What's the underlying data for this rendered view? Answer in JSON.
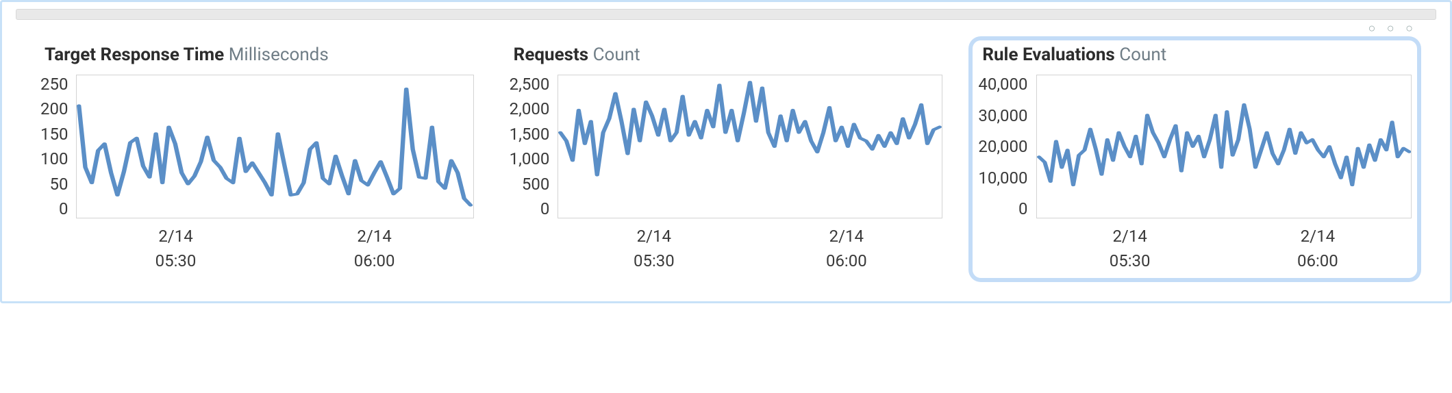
{
  "topbar": {
    "dots": "○ ○ ○"
  },
  "panels": [
    {
      "id": "response-time",
      "title": "Target Response Time",
      "unit": "Milliseconds",
      "selected": false,
      "yticks": [
        "250",
        "200",
        "150",
        "100",
        "50",
        "0"
      ],
      "xticks": [
        {
          "date": "2/14",
          "time": "05:30"
        },
        {
          "date": "2/14",
          "time": "06:00"
        }
      ]
    },
    {
      "id": "requests",
      "title": "Requests",
      "unit": "Count",
      "selected": false,
      "yticks": [
        "2,500",
        "2,000",
        "1,500",
        "1,000",
        "500",
        "0"
      ],
      "xticks": [
        {
          "date": "2/14",
          "time": "05:30"
        },
        {
          "date": "2/14",
          "time": "06:00"
        }
      ]
    },
    {
      "id": "rule-evaluations",
      "title": "Rule Evaluations",
      "unit": "Count",
      "selected": true,
      "yticks": [
        "40,000",
        "30,000",
        "20,000",
        "10,000",
        "0"
      ],
      "xticks": [
        {
          "date": "2/14",
          "time": "05:30"
        },
        {
          "date": "2/14",
          "time": "06:00"
        }
      ]
    }
  ],
  "chart_data": [
    {
      "type": "line",
      "title": "Target Response Time",
      "unit": "Milliseconds",
      "ylabel": "Milliseconds",
      "xlabel": "",
      "ylim": [
        0,
        250
      ],
      "x_range": [
        "2/14 05:00",
        "2/14 06:10"
      ],
      "x_tick_labels": [
        "2/14 05:30",
        "2/14 06:00"
      ],
      "series": [
        {
          "name": "Target Response Time",
          "values": [
            198,
            88,
            60,
            118,
            130,
            78,
            38,
            80,
            132,
            140,
            90,
            70,
            148,
            60,
            160,
            130,
            78,
            58,
            72,
            98,
            142,
            100,
            88,
            68,
            60,
            140,
            80,
            96,
            78,
            60,
            38,
            148,
            92,
            38,
            40,
            60,
            120,
            132,
            68,
            58,
            108,
            72,
            40,
            100,
            64,
            56,
            78,
            98,
            70,
            40,
            50,
            228,
            120,
            70,
            68,
            160,
            62,
            50,
            100,
            78,
            32,
            20
          ]
        }
      ]
    },
    {
      "type": "line",
      "title": "Requests",
      "unit": "Count",
      "ylabel": "Count",
      "xlabel": "",
      "ylim": [
        0,
        2500
      ],
      "x_range": [
        "2/14 05:00",
        "2/14 06:10"
      ],
      "x_tick_labels": [
        "2/14 05:30",
        "2/14 06:00"
      ],
      "series": [
        {
          "name": "Requests",
          "values": [
            1500,
            1350,
            1000,
            1900,
            1300,
            1700,
            740,
            1500,
            1750,
            2200,
            1700,
            1120,
            1920,
            1350,
            2050,
            1800,
            1450,
            1920,
            1350,
            1500,
            2150,
            1450,
            1700,
            1400,
            1900,
            1600,
            2350,
            1500,
            1900,
            1350,
            1850,
            2400,
            1700,
            2300,
            1500,
            1250,
            1800,
            1350,
            1900,
            1500,
            1700,
            1350,
            1150,
            1500,
            1950,
            1350,
            1600,
            1250,
            1650,
            1400,
            1350,
            1200,
            1450,
            1250,
            1500,
            1300,
            1750,
            1400,
            1650,
            2000,
            1300,
            1550,
            1600
          ]
        }
      ]
    },
    {
      "type": "line",
      "title": "Rule Evaluations",
      "unit": "Count",
      "ylabel": "Count",
      "xlabel": "",
      "ylim": [
        0,
        40000
      ],
      "x_range": [
        "2/14 05:00",
        "2/14 06:10"
      ],
      "x_tick_labels": [
        "2/14 05:30",
        "2/14 06:00"
      ],
      "series": [
        {
          "name": "Rule Evaluations",
          "values": [
            17000,
            15500,
            10000,
            21500,
            14000,
            19000,
            9000,
            17500,
            19000,
            25000,
            19000,
            12000,
            22000,
            16000,
            24000,
            20000,
            17000,
            23000,
            15000,
            29000,
            24000,
            21000,
            17000,
            22000,
            26000,
            13000,
            24000,
            20000,
            23000,
            17000,
            22000,
            29000,
            14000,
            30000,
            17500,
            22000,
            32000,
            25000,
            14000,
            19000,
            24000,
            18000,
            15000,
            19000,
            25000,
            18000,
            24000,
            21000,
            22000,
            19000,
            17000,
            20000,
            15000,
            11000,
            17000,
            9000,
            19500,
            14000,
            20500,
            16000,
            22000,
            19000,
            27000,
            17000,
            19500,
            18500
          ]
        }
      ]
    }
  ],
  "colors": {
    "line": "#5b8fc7"
  }
}
